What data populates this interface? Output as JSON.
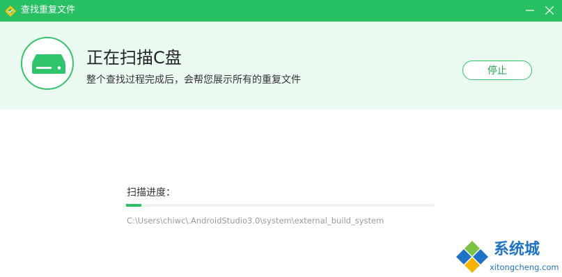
{
  "window": {
    "title": "查找重复文件",
    "icons": {
      "logo": "app-logo-icon",
      "minimize": "minimize-icon",
      "close": "close-icon"
    }
  },
  "header": {
    "disk_icon": "hard-disk-icon",
    "title": "正在扫描C盘",
    "subtitle": "整个查找过程完成后，会帮您展示所有的重复文件",
    "stop_button_label": "停止"
  },
  "progress": {
    "label": "扫描进度：",
    "value_fraction": 0.05,
    "current_path": "C:\\Users\\chiwc\\.AndroidStudio3.0\\system\\external_build_system"
  },
  "watermark": {
    "name_cn": "系统城",
    "domain": "xitongcheng.com"
  },
  "colors": {
    "brand_green": "#27c163",
    "header_bg": "#eafaf0",
    "watermark_blue": "#1e73c8"
  }
}
